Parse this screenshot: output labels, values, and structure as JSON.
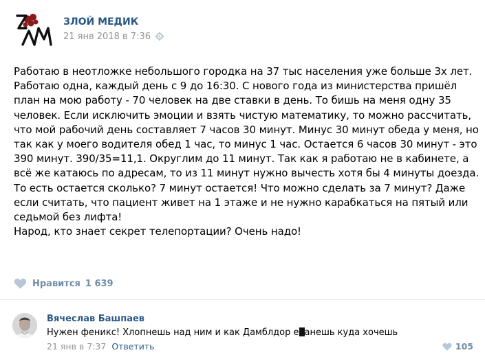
{
  "post": {
    "author": "ЗЛОЙ МЕДИК",
    "date": "21 янв 2018 в 7:36",
    "logo_icon": "zlm-logo-icon",
    "settings_icon": "gear-icon",
    "text_lines": [
      "Работаю в неотложке небольшого городка на 37 тыс населения уже больше 3х лет.",
      "Работаю одна, каждый день с 9 до 16:30. С нового года из министерства пришёл",
      "план на мою работу - 70 человек на две ставки в день. То бишь на меня одну 35",
      "человек. Если исключить эмоции и взять чистую математику, то можно рассчитать,",
      "что мой рабочий день составляет 7 часов 30 минут. Минус 30 минут обеда у меня, но",
      "так как у моего водителя обед 1 час, то минус 1 час. Остается 6 часов 30 минут - это",
      "390 минут. 390/35=11,1. Округлим до 11 минут. Так как я работаю не в кабинете, а",
      "всё же катаюсь по адресам, то из 11 минут нужно вычесть хотя бы 4 минуты доезда.",
      "То есть остается сколько? 7 минут остается! Что можно сделать за 7 минут? Даже",
      "если считать, что пациент живет на 1 этаже и не нужно карабкаться на пятый или",
      "седьмой без лифта!",
      "Народ, кто знает секрет телепортации? Очень надо!"
    ],
    "like_label": "Нравится",
    "like_count": "1 639",
    "like_icon": "heart-icon"
  },
  "comment": {
    "author": "Вячеслав Башпаев",
    "text_before": "Нужен феникс! Хлопнешь над ним и как Дамблдор е",
    "text_after": "анешь куда хочешь",
    "date": "21 янв в 7:37",
    "reply_label": "Ответить",
    "like_count": "105",
    "like_icon": "heart-icon"
  },
  "colors": {
    "link": "#2a5885",
    "muted": "#939393",
    "like": "#6f8dab",
    "logo_red": "#8b1a1a",
    "divider": "#e7e8ec"
  }
}
